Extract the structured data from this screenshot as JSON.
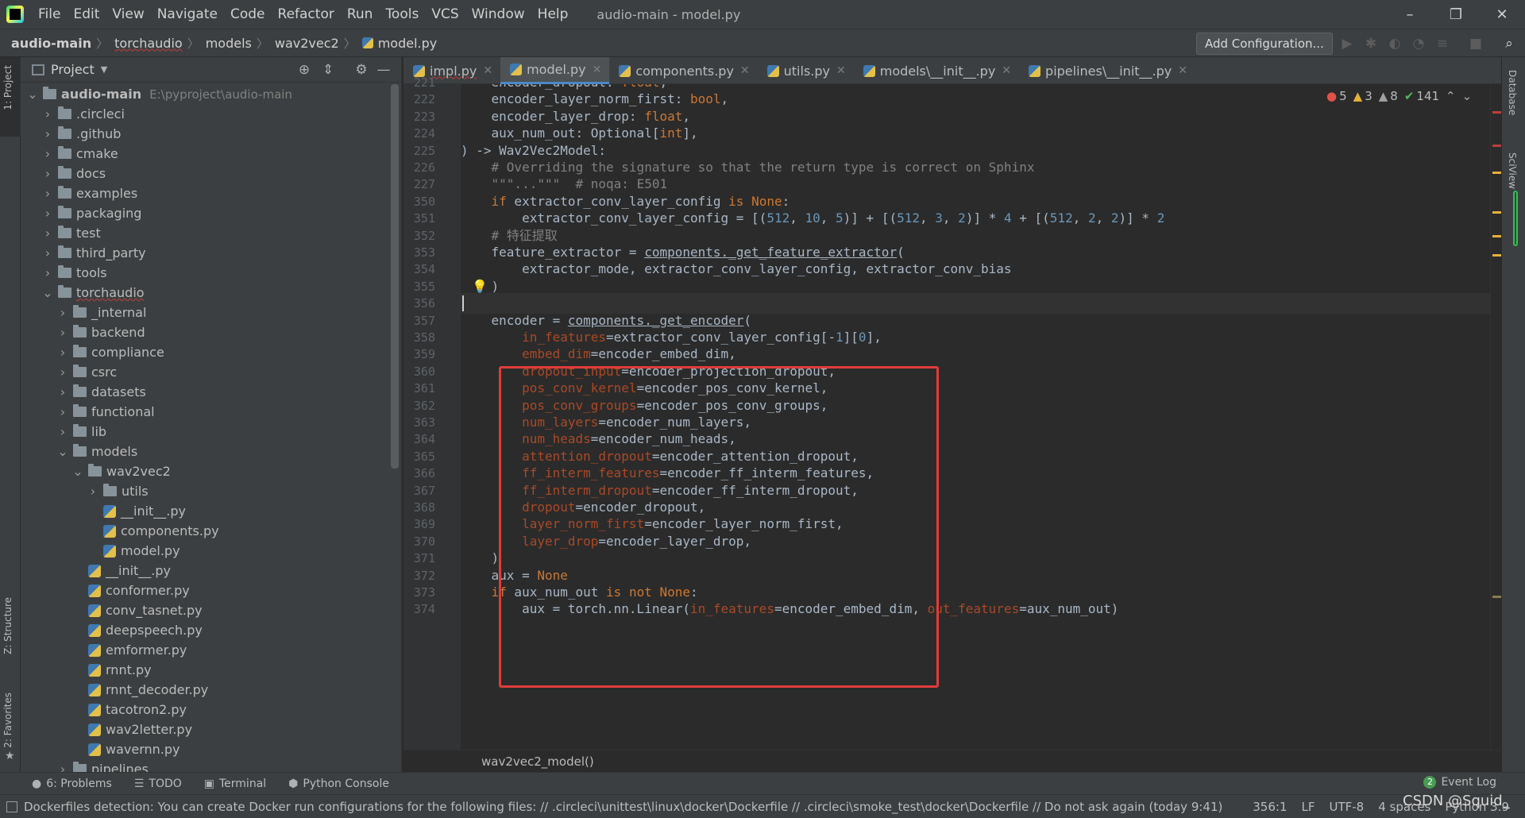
{
  "window": {
    "title": "audio-main - model.py",
    "menu": [
      "File",
      "Edit",
      "View",
      "Navigate",
      "Code",
      "Refactor",
      "Run",
      "Tools",
      "VCS",
      "Window",
      "Help"
    ],
    "controls": {
      "minimize": "–",
      "restore": "❐",
      "close": "✕"
    }
  },
  "nav": {
    "breadcrumbs": [
      "audio-main",
      "torchaudio",
      "models",
      "wav2vec2",
      "model.py"
    ],
    "add_config": "Add Configuration..."
  },
  "left_stripe": {
    "project": "1: Project",
    "structure": "Z: Structure",
    "favorites": "2: Favorites"
  },
  "right_stripe": {
    "database": "Database",
    "sciview": "SciView"
  },
  "project": {
    "title": "Project",
    "tree": [
      {
        "label": "audio-main",
        "path": "E:\\pyproject\\audio-main",
        "depth": 0,
        "type": "folder",
        "open": true,
        "bold": true
      },
      {
        "label": ".circleci",
        "depth": 1,
        "type": "folder"
      },
      {
        "label": ".github",
        "depth": 1,
        "type": "folder"
      },
      {
        "label": "cmake",
        "depth": 1,
        "type": "folder"
      },
      {
        "label": "docs",
        "depth": 1,
        "type": "folder"
      },
      {
        "label": "examples",
        "depth": 1,
        "type": "folder"
      },
      {
        "label": "packaging",
        "depth": 1,
        "type": "folder"
      },
      {
        "label": "test",
        "depth": 1,
        "type": "folder"
      },
      {
        "label": "third_party",
        "depth": 1,
        "type": "folder"
      },
      {
        "label": "tools",
        "depth": 1,
        "type": "folder"
      },
      {
        "label": "torchaudio",
        "depth": 1,
        "type": "folder",
        "open": true,
        "squiggle": true
      },
      {
        "label": "_internal",
        "depth": 2,
        "type": "folder"
      },
      {
        "label": "backend",
        "depth": 2,
        "type": "folder"
      },
      {
        "label": "compliance",
        "depth": 2,
        "type": "folder"
      },
      {
        "label": "csrc",
        "depth": 2,
        "type": "folder"
      },
      {
        "label": "datasets",
        "depth": 2,
        "type": "folder"
      },
      {
        "label": "functional",
        "depth": 2,
        "type": "folder"
      },
      {
        "label": "lib",
        "depth": 2,
        "type": "folder"
      },
      {
        "label": "models",
        "depth": 2,
        "type": "folder",
        "open": true
      },
      {
        "label": "wav2vec2",
        "depth": 3,
        "type": "folder",
        "open": true
      },
      {
        "label": "utils",
        "depth": 4,
        "type": "folder"
      },
      {
        "label": "__init__.py",
        "depth": 4,
        "type": "file"
      },
      {
        "label": "components.py",
        "depth": 4,
        "type": "file"
      },
      {
        "label": "model.py",
        "depth": 4,
        "type": "file"
      },
      {
        "label": "__init__.py",
        "depth": 3,
        "type": "file"
      },
      {
        "label": "conformer.py",
        "depth": 3,
        "type": "file"
      },
      {
        "label": "conv_tasnet.py",
        "depth": 3,
        "type": "file"
      },
      {
        "label": "deepspeech.py",
        "depth": 3,
        "type": "file"
      },
      {
        "label": "emformer.py",
        "depth": 3,
        "type": "file"
      },
      {
        "label": "rnnt.py",
        "depth": 3,
        "type": "file"
      },
      {
        "label": "rnnt_decoder.py",
        "depth": 3,
        "type": "file"
      },
      {
        "label": "tacotron2.py",
        "depth": 3,
        "type": "file"
      },
      {
        "label": "wav2letter.py",
        "depth": 3,
        "type": "file"
      },
      {
        "label": "wavernn.py",
        "depth": 3,
        "type": "file"
      },
      {
        "label": "pipelines",
        "depth": 2,
        "type": "folder"
      }
    ]
  },
  "tabs": [
    {
      "label": "impl.py",
      "active": false,
      "squiggle": true
    },
    {
      "label": "model.py",
      "active": true
    },
    {
      "label": "components.py",
      "active": false
    },
    {
      "label": "utils.py",
      "active": false
    },
    {
      "label": "models\\__init__.py",
      "active": false
    },
    {
      "label": "pipelines\\__init__.py",
      "active": false
    }
  ],
  "inspections": {
    "errors": "5",
    "warnings": "3",
    "weak_warnings": "8",
    "typos": "141"
  },
  "code": [
    {
      "n": "221",
      "t": "    encoder_dropout: float,"
    },
    {
      "n": "222",
      "t": "    encoder_layer_norm_first: bool,"
    },
    {
      "n": "223",
      "t": "    encoder_layer_drop: float,"
    },
    {
      "n": "224",
      "t": "    aux_num_out: Optional[int],"
    },
    {
      "n": "225",
      "t": ") -> Wav2Vec2Model:"
    },
    {
      "n": "226",
      "t": "    # Overriding the signature so that the return type is correct on Sphinx"
    },
    {
      "n": "227",
      "t": "    \"\"\"...\"\"\"  # noqa: E501"
    },
    {
      "n": "350",
      "t": "    if extractor_conv_layer_config is None:"
    },
    {
      "n": "351",
      "t": "        extractor_conv_layer_config = [(512, 10, 5)] + [(512, 3, 2)] * 4 + [(512, 2, 2)] * 2"
    },
    {
      "n": "352",
      "t": "    # 特征提取"
    },
    {
      "n": "353",
      "t": "    feature_extractor = components._get_feature_extractor("
    },
    {
      "n": "354",
      "t": "        extractor_mode, extractor_conv_layer_config, extractor_conv_bias"
    },
    {
      "n": "355",
      "t": "    )"
    },
    {
      "n": "356",
      "t": ""
    },
    {
      "n": "357",
      "t": "    encoder = components._get_encoder("
    },
    {
      "n": "358",
      "t": "        in_features=extractor_conv_layer_config[-1][0],"
    },
    {
      "n": "359",
      "t": "        embed_dim=encoder_embed_dim,"
    },
    {
      "n": "360",
      "t": "        dropout_input=encoder_projection_dropout,"
    },
    {
      "n": "361",
      "t": "        pos_conv_kernel=encoder_pos_conv_kernel,"
    },
    {
      "n": "362",
      "t": "        pos_conv_groups=encoder_pos_conv_groups,"
    },
    {
      "n": "363",
      "t": "        num_layers=encoder_num_layers,"
    },
    {
      "n": "364",
      "t": "        num_heads=encoder_num_heads,"
    },
    {
      "n": "365",
      "t": "        attention_dropout=encoder_attention_dropout,"
    },
    {
      "n": "366",
      "t": "        ff_interm_features=encoder_ff_interm_features,"
    },
    {
      "n": "367",
      "t": "        ff_interm_dropout=encoder_ff_interm_dropout,"
    },
    {
      "n": "368",
      "t": "        dropout=encoder_dropout,"
    },
    {
      "n": "369",
      "t": "        layer_norm_first=encoder_layer_norm_first,"
    },
    {
      "n": "370",
      "t": "        layer_drop=encoder_layer_drop,"
    },
    {
      "n": "371",
      "t": "    )"
    },
    {
      "n": "372",
      "t": "    aux = None"
    },
    {
      "n": "373",
      "t": "    if aux_num_out is not None:"
    },
    {
      "n": "374",
      "t": "        aux = torch.nn.Linear(in_features=encoder_embed_dim, out_features=aux_num_out)"
    }
  ],
  "current_line": "356",
  "bottom_breadcrumb": "wav2vec2_model()",
  "toolwindows": [
    {
      "label": "6: Problems",
      "icon": "problems-icon"
    },
    {
      "label": "TODO",
      "icon": "todo-icon"
    },
    {
      "label": "Terminal",
      "icon": "terminal-icon"
    },
    {
      "label": "Python Console",
      "icon": "python-console-icon"
    }
  ],
  "event_log": {
    "label": "Event Log",
    "count": "2"
  },
  "status": {
    "message": "Dockerfiles detection: You can create Docker run configurations for the following files: // .circleci\\unittest\\linux\\docker\\Dockerfile // .circleci\\smoke_test\\docker\\Dockerfile // Do not ask again (today 9:41)",
    "position": "356:1",
    "line_sep": "LF",
    "encoding": "UTF-8",
    "indent": "4 spaces",
    "interpreter": "Python 3.9"
  },
  "watermark": "CSDN @Squid_",
  "colors": {
    "accent": "#4a88c7",
    "highlight_box": "#e13b3b",
    "keyword": "#cc7832",
    "number": "#6897bb",
    "param": "#aa4926"
  }
}
